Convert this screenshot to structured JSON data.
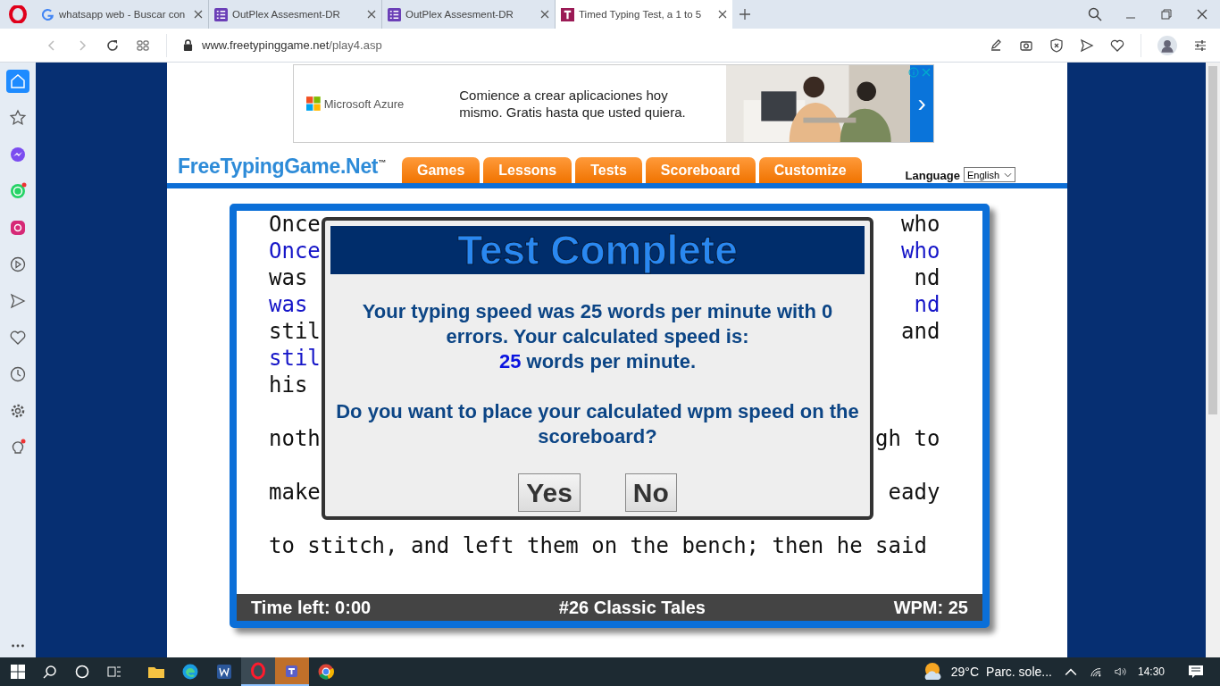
{
  "browser": {
    "tabs": [
      {
        "title": "whatsapp web - Buscar con",
        "selected": false
      },
      {
        "title": "OutPlex Assesment-DR",
        "selected": false
      },
      {
        "title": "OutPlex Assesment-DR",
        "selected": false
      },
      {
        "title": "Timed Typing Test, a 1 to 5",
        "selected": true
      }
    ],
    "address": {
      "domain": "www.freetypinggame.net",
      "path": "/play4.asp"
    },
    "sidebar": [
      {
        "selected": true
      },
      {
        "selected": false
      },
      {
        "selected": false
      },
      {
        "selected": false
      },
      {
        "selected": false
      },
      {
        "selected": false
      },
      {
        "selected": false
      },
      {
        "selected": false
      },
      {
        "selected": false
      },
      {
        "selected": false
      },
      {
        "selected": false
      }
    ]
  },
  "ad": {
    "brand": "Microsoft Azure",
    "text": "Comience a crear aplicaciones hoy mismo. Gratis hasta que usted quiera.",
    "arrow": "›"
  },
  "site": {
    "logo": "FreeTypingGame.Net",
    "logo_mark": "™",
    "nav": [
      "Games",
      "Lessons",
      "Tests",
      "Scoreboard",
      "Customize"
    ],
    "language": {
      "label": "Language",
      "value": "English"
    }
  },
  "typing": {
    "lines": [
      {
        "kind": "source",
        "left": "Once",
        "right": "who"
      },
      {
        "kind": "typed",
        "left": "Once",
        "right": "who"
      },
      {
        "kind": "source",
        "left": "was",
        "right": "nd"
      },
      {
        "kind": "typed",
        "left": "was",
        "right": "nd"
      },
      {
        "kind": "source",
        "left": "stil",
        "right": "and"
      },
      {
        "kind": "typed",
        "left": "stil"
      },
      {
        "kind": "source",
        "left": "his"
      },
      {
        "kind": "blank"
      },
      {
        "kind": "source",
        "left": "noth",
        "right": "gh to"
      },
      {
        "kind": "blank"
      },
      {
        "kind": "source",
        "left": "make",
        "right": "eady"
      },
      {
        "kind": "blank"
      },
      {
        "kind": "source",
        "left": "to stitch, and left them on the bench; then he said"
      }
    ],
    "status": {
      "time": "Time left: 0:00",
      "title": "#26 Classic Tales",
      "wpm": "WPM: 25"
    }
  },
  "dialog": {
    "title": "Test Complete",
    "message": "Your typing speed was 25 words per minute with 0 errors. Your calculated speed is:",
    "speed": "25",
    "speed_suffix": "words per minute.",
    "question": "Do you want to place your calculated wpm speed on the scoreboard?",
    "buttons": [
      "Yes",
      "No"
    ]
  },
  "taskbar": {
    "apps": [
      {
        "selected": false
      },
      {
        "selected": false
      },
      {
        "selected": false
      },
      {
        "selected": true
      },
      {
        "selected": true
      },
      {
        "selected": false
      }
    ],
    "temperature": "29°C",
    "weather": "Parc. sole...",
    "time": "14:30"
  }
}
